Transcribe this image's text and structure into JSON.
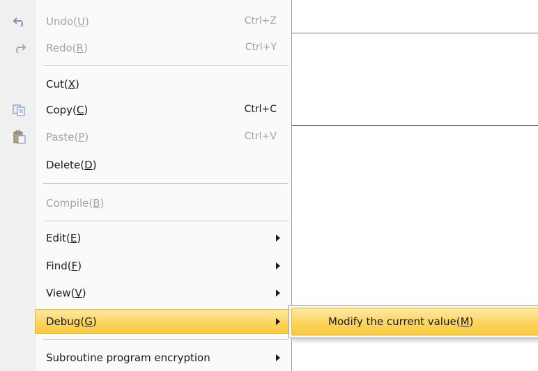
{
  "menu": {
    "items": [
      {
        "name": "undo",
        "label_text": "Undo(",
        "accel": "U",
        "label_end": ")",
        "shortcut": "Ctrl+Z",
        "disabled": true,
        "icon": "undo-icon"
      },
      {
        "name": "redo",
        "label_text": "Redo(",
        "accel": "R",
        "label_end": ")",
        "shortcut": "Ctrl+Y",
        "disabled": true,
        "icon": "redo-icon"
      },
      {
        "name": "cut",
        "label_text": "Cut(",
        "accel": "X",
        "label_end": ")",
        "shortcut": "",
        "disabled": false,
        "icon": ""
      },
      {
        "name": "copy",
        "label_text": "Copy(",
        "accel": "C",
        "label_end": ")",
        "shortcut": "Ctrl+C",
        "disabled": false,
        "icon": "copy-icon"
      },
      {
        "name": "paste",
        "label_text": "Paste(",
        "accel": "P",
        "label_end": ")",
        "shortcut": "Ctrl+V",
        "disabled": true,
        "icon": "paste-icon"
      },
      {
        "name": "delete",
        "label_text": "Delete(",
        "accel": "D",
        "label_end": ")",
        "shortcut": "",
        "disabled": false,
        "icon": ""
      },
      {
        "name": "compile",
        "label_text": "Compile(",
        "accel": "B",
        "label_end": ")",
        "shortcut": "",
        "disabled": true,
        "icon": ""
      },
      {
        "name": "edit",
        "label_text": "Edit(",
        "accel": "E",
        "label_end": ")",
        "submenu": true
      },
      {
        "name": "find",
        "label_text": "Find(",
        "accel": "F",
        "label_end": ")",
        "submenu": true
      },
      {
        "name": "view",
        "label_text": "View(",
        "accel": "V",
        "label_end": ")",
        "submenu": true
      },
      {
        "name": "debug",
        "label_text": "Debug(",
        "accel": "G",
        "label_end": ")",
        "submenu": true,
        "highlighted": true
      },
      {
        "name": "subroutine-encryption",
        "label_text": "Subroutine program encryption",
        "accel": "",
        "label_end": "",
        "submenu": true
      }
    ]
  },
  "submenu": {
    "label_text": "Modify the current value(",
    "accel": "M",
    "label_end": ")"
  },
  "colors": {
    "highlight": "#fbd55f",
    "disabled_text": "#a3a3a3",
    "gutter": "#f0f0f0"
  }
}
